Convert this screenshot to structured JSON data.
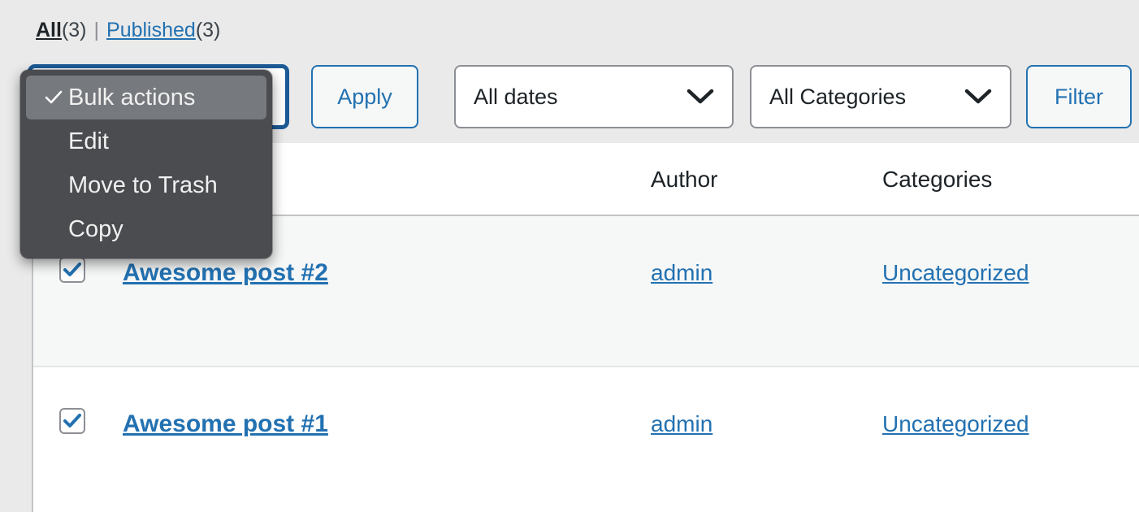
{
  "filter_links": {
    "items": [
      {
        "label": "All",
        "count": "(3)",
        "current": true
      },
      {
        "label": "Published",
        "count": "(3)",
        "current": false
      }
    ],
    "separator": "|"
  },
  "toolbar": {
    "bulk_select_value": "Bulk actions",
    "apply_label": "Apply",
    "dates_select_value": "All dates",
    "categories_select_value": "All Categories",
    "filter_label": "Filter"
  },
  "bulk_actions_menu": {
    "items": [
      {
        "label": "Bulk actions",
        "selected": true
      },
      {
        "label": "Edit",
        "selected": false
      },
      {
        "label": "Move to Trash",
        "selected": false
      },
      {
        "label": "Copy",
        "selected": false
      }
    ]
  },
  "table": {
    "columns": {
      "checkbox": "",
      "title": "",
      "author": "Author",
      "categories": "Categories"
    },
    "rows": [
      {
        "checked": true,
        "title": "Awesome post #2",
        "author": "admin",
        "categories": "Uncategorized"
      },
      {
        "checked": true,
        "title": "Awesome post #1",
        "author": "admin",
        "categories": "Uncategorized"
      }
    ]
  },
  "colors": {
    "link": "#2271b1",
    "page_bg": "#eaeaea",
    "menu_bg": "#4a4c50",
    "menu_selected_bg": "#76797d",
    "row_alt_bg": "#f6f7f7",
    "border": "#c3c4c7"
  }
}
